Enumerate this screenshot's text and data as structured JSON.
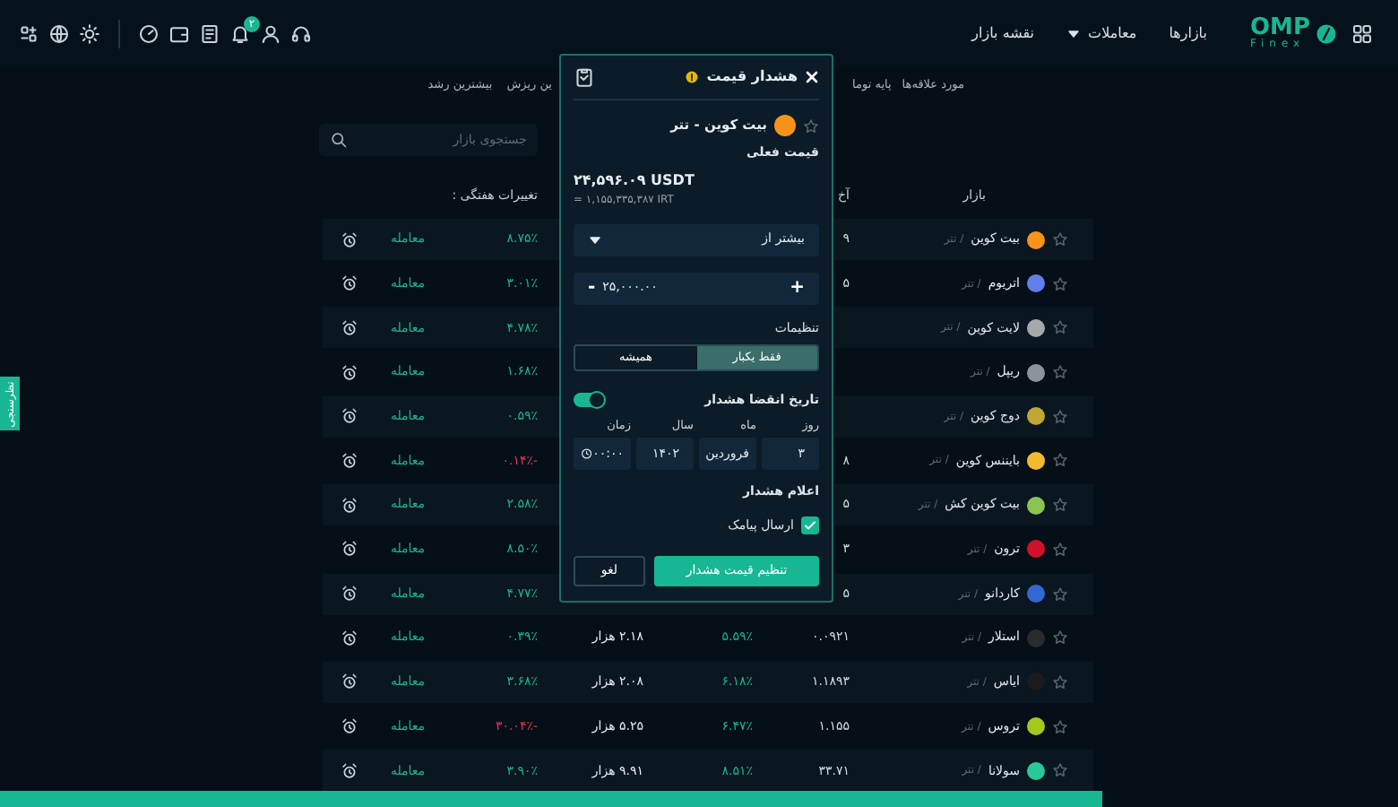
{
  "header": {
    "logo": {
      "brand": "OMP",
      "sub": "Finex"
    },
    "nav": [
      {
        "label": "بازارها",
        "dropdown": false
      },
      {
        "label": "معاملات",
        "dropdown": true
      },
      {
        "label": "نقشه بازار",
        "dropdown": false
      }
    ],
    "notification_badge": "۲"
  },
  "subnav": [
    {
      "label": "مورد علاقه‌ها"
    },
    {
      "label": "پایه توما"
    },
    {
      "label": "ین ریزش"
    },
    {
      "label": "بیشترین رشد"
    }
  ],
  "side_tab": "نظرسنجی",
  "search": {
    "placeholder": "جستجوی بازار"
  },
  "table": {
    "columns": [
      "بازار",
      "آخ",
      "تغییرات هفتگی :"
    ],
    "rows": [
      {
        "coin": "بیت کوین",
        "quote": "/ تتر",
        "color": "#f7931a",
        "last_price": "۹",
        "weekly_change": "۸.۷۵٪",
        "negative": false,
        "action": "معامله"
      },
      {
        "coin": "اتریوم",
        "quote": "/ تتر",
        "color": "#627eea",
        "last_price": "۵",
        "weekly_change": "۳.۰۱٪",
        "negative": false,
        "action": "معامله"
      },
      {
        "coin": "لایت کوین",
        "quote": "/ تتر",
        "color": "#a6a9aa",
        "weekly_change": "۴.۷۸٪",
        "negative": false,
        "action": "معامله"
      },
      {
        "coin": "ریپل",
        "quote": "/ تتر",
        "color": "#8a949c",
        "weekly_change": "۱.۶۸٪",
        "negative": false,
        "action": "معامله"
      },
      {
        "coin": "دوج کوین",
        "quote": "/ تتر",
        "color": "#c2a633",
        "weekly_change": "۰.۵۹٪",
        "negative": false,
        "action": "معامله"
      },
      {
        "coin": "بایننس کوین",
        "quote": "/ تتر",
        "color": "#f3ba2f",
        "last_price": "۸",
        "weekly_change": "-۰.۱۴٪",
        "negative": true,
        "action": "معامله"
      },
      {
        "coin": "بیت کوین کش",
        "quote": "/ تتر",
        "color": "#8dc351",
        "last_price": "۵",
        "weekly_change": "۲.۵۸٪",
        "negative": false,
        "action": "معامله"
      },
      {
        "coin": "ترون",
        "quote": "/ تتر",
        "color": "#d0112b",
        "last_price": "۳",
        "weekly_change": "۸.۵۰٪",
        "negative": false,
        "action": "معامله"
      },
      {
        "coin": "کاردانو",
        "quote": "/ تتر",
        "color": "#3468d1",
        "last_price": "۵",
        "weekly_change": "۴.۷۷٪",
        "negative": false,
        "action": "معامله"
      },
      {
        "coin": "استلار",
        "quote": "/ تتر",
        "color": "#2b2b2b",
        "last_price": "۰.۰۹۲۱",
        "change_24h": "۵.۵۹٪",
        "volume": "۲.۱۸ هزار",
        "weekly_change": "۰.۳۹٪",
        "negative": false,
        "action": "معامله"
      },
      {
        "coin": "ایاس",
        "quote": "/ تتر",
        "color": "#1b1b1b",
        "last_price": "۱.۱۸۹۳",
        "change_24h": "۶.۱۸٪",
        "volume": "۲.۰۸ هزار",
        "weekly_change": "۳.۶۸٪",
        "negative": false,
        "action": "معامله"
      },
      {
        "coin": "تروس",
        "quote": "/ تتر",
        "color": "#a4c81c",
        "last_price": "۱.۱۵۵",
        "change_24h": "۶.۴۷٪",
        "volume": "۵.۲۵ هزار",
        "weekly_change": "-۳۰.۰۴٪",
        "negative": true,
        "action": "معامله"
      },
      {
        "coin": "سولانا",
        "quote": "/ تتر",
        "color": "#27c99a",
        "last_price": "۳۳.۷۱",
        "change_24h": "۸.۵۱٪",
        "volume": "۹.۹۱ هزار",
        "weekly_change": "۳.۹۰٪",
        "negative": false,
        "action": "معامله"
      }
    ]
  },
  "modal": {
    "title": "هشدار قیمت",
    "pair": "بیت کوین - تتر",
    "current_price_label": "قیمت فعلی",
    "price": "۲۴,۵۹۶.۰۹ USDT",
    "price_irt": "= ۱,۱۵۵,۳۳۵,۳۸۷ IRT",
    "condition": "بیشتر از",
    "amount": "۲۵,۰۰۰.۰۰",
    "increment": "+",
    "decrement": "-",
    "settings_label": "تنظیمات",
    "frequency": [
      {
        "label": "فقط یکبار",
        "selected": true
      },
      {
        "label": "همیشه",
        "selected": false
      }
    ],
    "expiry": {
      "label": "تاریخ انقضا هشدار",
      "on": true,
      "fields": [
        {
          "label": "روز",
          "value": "۳",
          "kind": "text"
        },
        {
          "label": "ماه",
          "value": "فروردین",
          "kind": "select"
        },
        {
          "label": "سال",
          "value": "۱۴۰۲",
          "kind": "text"
        },
        {
          "label": "زمان",
          "value": "۰۰:۰۰",
          "kind": "time"
        }
      ]
    },
    "notify_label": "اعلام هشدار",
    "notify_options": [
      {
        "label": "ارسال پیامک",
        "checked": true
      }
    ],
    "submit": "تنظیم قیمت هشدار",
    "cancel": "لغو"
  }
}
